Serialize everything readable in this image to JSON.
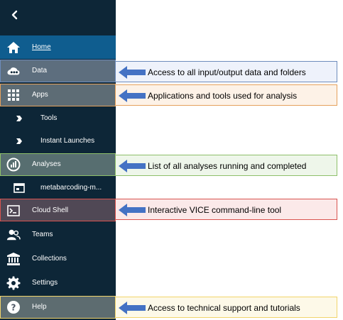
{
  "sidebar": {
    "items": [
      {
        "label": "Home",
        "icon": "home-icon"
      },
      {
        "label": "Data",
        "icon": "cloud-data-icon"
      },
      {
        "label": "Apps",
        "icon": "apps-grid-icon"
      },
      {
        "label": "Tools",
        "icon": "chevron-right-icon"
      },
      {
        "label": "Instant Launches",
        "icon": "chevron-right-icon"
      },
      {
        "label": "Analyses",
        "icon": "analyses-gauge-icon"
      },
      {
        "label": "metabarcoding-m...",
        "icon": "window-icon"
      },
      {
        "label": "Cloud Shell",
        "icon": "terminal-icon"
      },
      {
        "label": "Teams",
        "icon": "teams-icon"
      },
      {
        "label": "Collections",
        "icon": "collections-icon"
      },
      {
        "label": "Settings",
        "icon": "gear-icon"
      },
      {
        "label": "Help",
        "icon": "help-icon"
      }
    ]
  },
  "callouts": [
    {
      "text": "Access to all input/output data and folders",
      "color": "#6d8cbc"
    },
    {
      "text": "Applications and tools used for analysis",
      "color": "#e5a15c"
    },
    {
      "text": "List of all analyses running and completed",
      "color": "#8ec06a"
    },
    {
      "text": "Interactive VICE command-line tool",
      "color": "#d9534f"
    },
    {
      "text": "Access to technical support and tutorials",
      "color": "#f1d46b"
    }
  ],
  "colors": {
    "sidebar_bg": "#0d2637",
    "active_bg": "#0f5d8f",
    "arrow": "#4472c4"
  }
}
